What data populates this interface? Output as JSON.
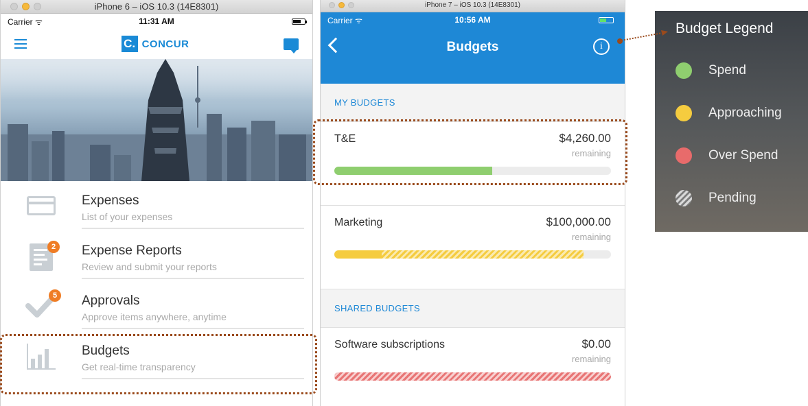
{
  "phone1": {
    "window_title": "iPhone 6 – iOS 10.3 (14E8301)",
    "status": {
      "carrier": "Carrier",
      "time": "11:31 AM"
    },
    "brand": {
      "mark": "C.",
      "word": "CONCUR"
    },
    "menu": [
      {
        "title": "Expenses",
        "subtitle": "List of your expenses",
        "icon": "credit-card-icon",
        "badge": ""
      },
      {
        "title": "Expense Reports",
        "subtitle": "Review and submit your reports",
        "icon": "report-icon",
        "badge": "2"
      },
      {
        "title": "Approvals",
        "subtitle": "Approve items anywhere, anytime",
        "icon": "checkmark-icon",
        "badge": "5"
      },
      {
        "title": "Budgets",
        "subtitle": "Get real-time transparency",
        "icon": "bar-chart-icon",
        "badge": ""
      }
    ]
  },
  "phone2": {
    "window_title": "iPhone 7 – iOS 10.3 (14E8301)",
    "status": {
      "carrier": "Carrier",
      "time": "10:56 AM"
    },
    "nav_title": "Budgets",
    "info_glyph": "i",
    "sections": {
      "my": "MY BUDGETS",
      "shared": "SHARED BUDGETS"
    },
    "my_budgets": [
      {
        "name": "T&E",
        "amount": "$4,260.00",
        "remaining_label": "remaining",
        "spend_pct": 57,
        "pending_pct": 0,
        "status": "spend"
      },
      {
        "name": "Marketing",
        "amount": "$100,000.00",
        "remaining_label": "remaining",
        "spend_pct": 17,
        "pending_pct": 73,
        "status": "approaching"
      }
    ],
    "shared_budgets": [
      {
        "name": "Software subscriptions",
        "amount": "$0.00",
        "remaining_label": "remaining",
        "spend_pct": 0,
        "pending_pct": 100,
        "status": "over-spend"
      }
    ]
  },
  "legend": {
    "title": "Budget Legend",
    "items": [
      {
        "label": "Spend",
        "color": "#8fce6f"
      },
      {
        "label": "Approaching",
        "color": "#f5cc3f"
      },
      {
        "label": "Over Spend",
        "color": "#e86b6b"
      },
      {
        "label": "Pending",
        "color": "pattern"
      }
    ]
  },
  "colors": {
    "accent": "#1e88d6",
    "highlight": "#9a4a1c",
    "badge": "#ef7d25"
  }
}
